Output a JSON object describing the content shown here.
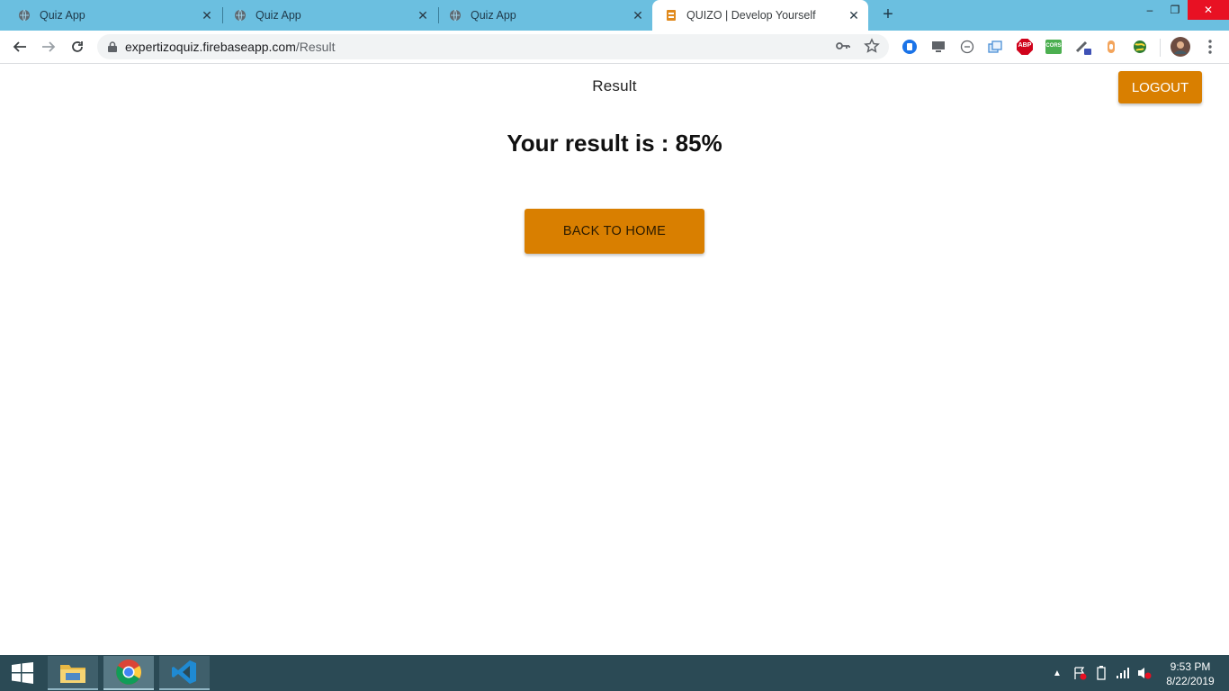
{
  "browser": {
    "tabs": [
      {
        "title": "Quiz App",
        "active": false,
        "favicon": "globe-icon"
      },
      {
        "title": "Quiz App",
        "active": false,
        "favicon": "globe-icon"
      },
      {
        "title": "Quiz App",
        "active": false,
        "favicon": "globe-icon"
      },
      {
        "title": "QUIZO | Develop Yourself",
        "active": true,
        "favicon": "quizo-favicon"
      }
    ],
    "new_tab": "+",
    "window_controls": {
      "minimize": "–",
      "restore": "❐",
      "close": "✕"
    },
    "url": {
      "host": "expertizoquiz.firebaseapp.com",
      "path": "/Result"
    },
    "extensions": [
      "shield-icon",
      "monitor-icon",
      "sync-icon",
      "tabs-icon",
      "adblock-icon",
      "cors-icon",
      "dropper-icon",
      "flask-icon",
      "globe-ext-icon",
      "profile-avatar"
    ],
    "ext_labels": {
      "abp": "ABP",
      "cors": "CORS"
    }
  },
  "page": {
    "title": "Result",
    "logout_label": "LOGOUT",
    "result_text": "Your result is : 85%",
    "back_home_label": "BACK TO HOME"
  },
  "colors": {
    "tabstrip": "#6bbfe0",
    "accent": "#d97f00",
    "taskbar": "#2b4a55"
  },
  "taskbar": {
    "apps": [
      "file-explorer-icon",
      "chrome-icon",
      "vscode-icon"
    ],
    "time": "9:53 PM",
    "date": "8/22/2019"
  }
}
